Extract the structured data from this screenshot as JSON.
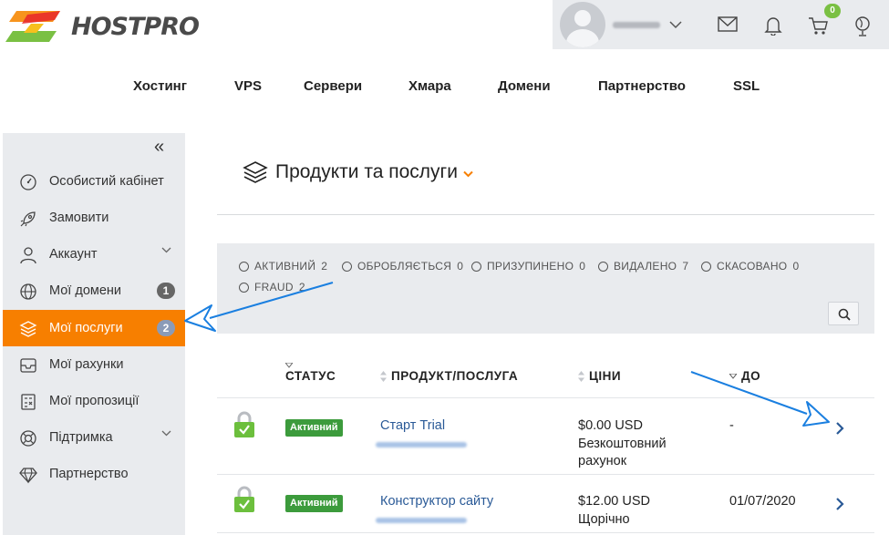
{
  "brand": {
    "name": "HOSTPRO"
  },
  "userbar": {
    "cart_count": "0",
    "icons": [
      "user-avatar",
      "chevron-down-icon",
      "mail-icon",
      "bell-icon",
      "cart-icon",
      "globe-icon"
    ]
  },
  "topnav": [
    "Хостинг",
    "VPS",
    "Сервери",
    "Хмара",
    "Домени",
    "Партнерство",
    "SSL"
  ],
  "sidebar": {
    "collapse_label": "«",
    "items": [
      {
        "label": "Особистий кабінет",
        "icon": "dashboard-icon"
      },
      {
        "label": "Замовити",
        "icon": "rocket-icon"
      },
      {
        "label": "Аккаунт",
        "icon": "user-icon",
        "expandable": true
      },
      {
        "label": "Мої домени",
        "icon": "globe-icon",
        "badge": "1"
      },
      {
        "label": "Мої послуги",
        "icon": "layers-icon",
        "badge": "2",
        "active": true
      },
      {
        "label": "Мої рахунки",
        "icon": "inbox-icon"
      },
      {
        "label": "Мої пропозиції",
        "icon": "calculator-icon"
      },
      {
        "label": "Підтримка",
        "icon": "lifebuoy-icon",
        "expandable": true
      },
      {
        "label": "Партнерство",
        "icon": "diamond-icon"
      }
    ]
  },
  "page": {
    "title": "Продукти та послуги"
  },
  "filters": [
    {
      "label": "АКТИВНИЙ",
      "count": "2"
    },
    {
      "label": "ОБРОБЛЯЄТЬСЯ",
      "count": "0"
    },
    {
      "label": "ПРИЗУПИНЕНО",
      "count": "0"
    },
    {
      "label": "ВИДАЛЕНО",
      "count": "7"
    },
    {
      "label": "СКАСОВАНО",
      "count": "0"
    },
    {
      "label": "FRAUD",
      "count": "2"
    }
  ],
  "table": {
    "columns": [
      "СТАТУС",
      "ПРОДУКТ/ПОСЛУГА",
      "ЦІНИ",
      "ДО"
    ],
    "rows": [
      {
        "status": "Активний",
        "product": "Старт Trial",
        "price": "$0.00 USD",
        "cycle_line1": "Безкоштовний",
        "cycle_line2": "рахунок",
        "due": "-"
      },
      {
        "status": "Активний",
        "product": "Конструктор сайту",
        "price": "$12.00 USD",
        "cycle_line1": "Щорічно",
        "cycle_line2": "",
        "due": "01/07/2020"
      }
    ]
  },
  "colors": {
    "accent": "#f77f00",
    "status_green": "#3c9b3c",
    "link": "#2a5a97",
    "panel": "#e9ebee",
    "annotation": "#1a7fe0"
  }
}
